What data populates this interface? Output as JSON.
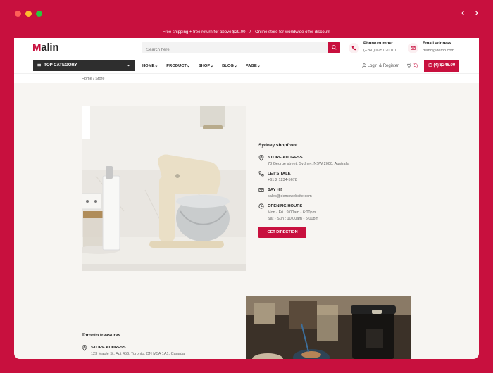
{
  "colors": {
    "brand": "#c8103e",
    "dark": "#2e2e2e",
    "page_bg": "#f7f5f2"
  },
  "topbar": {
    "shipping_text": "Free shipping + free return for above $29.00",
    "separator": "/",
    "online_text": "Online store for worldwide offer discount"
  },
  "header": {
    "logo_initial": "M",
    "logo_rest": "alin",
    "search_placeholder": "Search here",
    "phone_label": "Phone number",
    "phone_value": "(+260) 025 020 010",
    "email_label": "Email address",
    "email_value": "demo@demo.com"
  },
  "nav": {
    "top_category": "TOP CATEGORY",
    "items": [
      "HOME",
      "PRODUCT",
      "SHOP",
      "BLOG",
      "PAGE"
    ],
    "login": "Login & Register",
    "wishlist": "(5)",
    "cart": "(4) $246.00"
  },
  "breadcrumb": "Home / Store",
  "stores": [
    {
      "name": "Sydney shopfront",
      "address_label": "STORE ADDRESS",
      "address": "78 George street, Sydney, NSW 2000, Australia",
      "talk_label": "LET'S TALK",
      "phone": "+61 2 1234-5678",
      "say_label": "SAY HI!",
      "email": "sales@demowebsite.com",
      "hours_label": "OPENING HOURS",
      "hours_weekday": "Mon - Fri : 9:00am - 6:00pm",
      "hours_weekend": "Sat - Sun : 10:00am - 5:00pm",
      "button": "GET DIRECTION"
    },
    {
      "name": "Toronto treasures",
      "address_label": "STORE ADDRESS",
      "address": "123 Maple St, Apt 456, Toronto, ON M5A 1A1, Canada"
    }
  ],
  "icons": {
    "back": "chevron-left-icon",
    "forward": "chevron-right-icon",
    "search": "search-icon",
    "phone": "phone-icon",
    "email": "mail-icon",
    "user": "user-icon",
    "heart": "heart-icon",
    "bag": "bag-icon",
    "location": "map-pin-icon",
    "clock": "clock-icon"
  }
}
